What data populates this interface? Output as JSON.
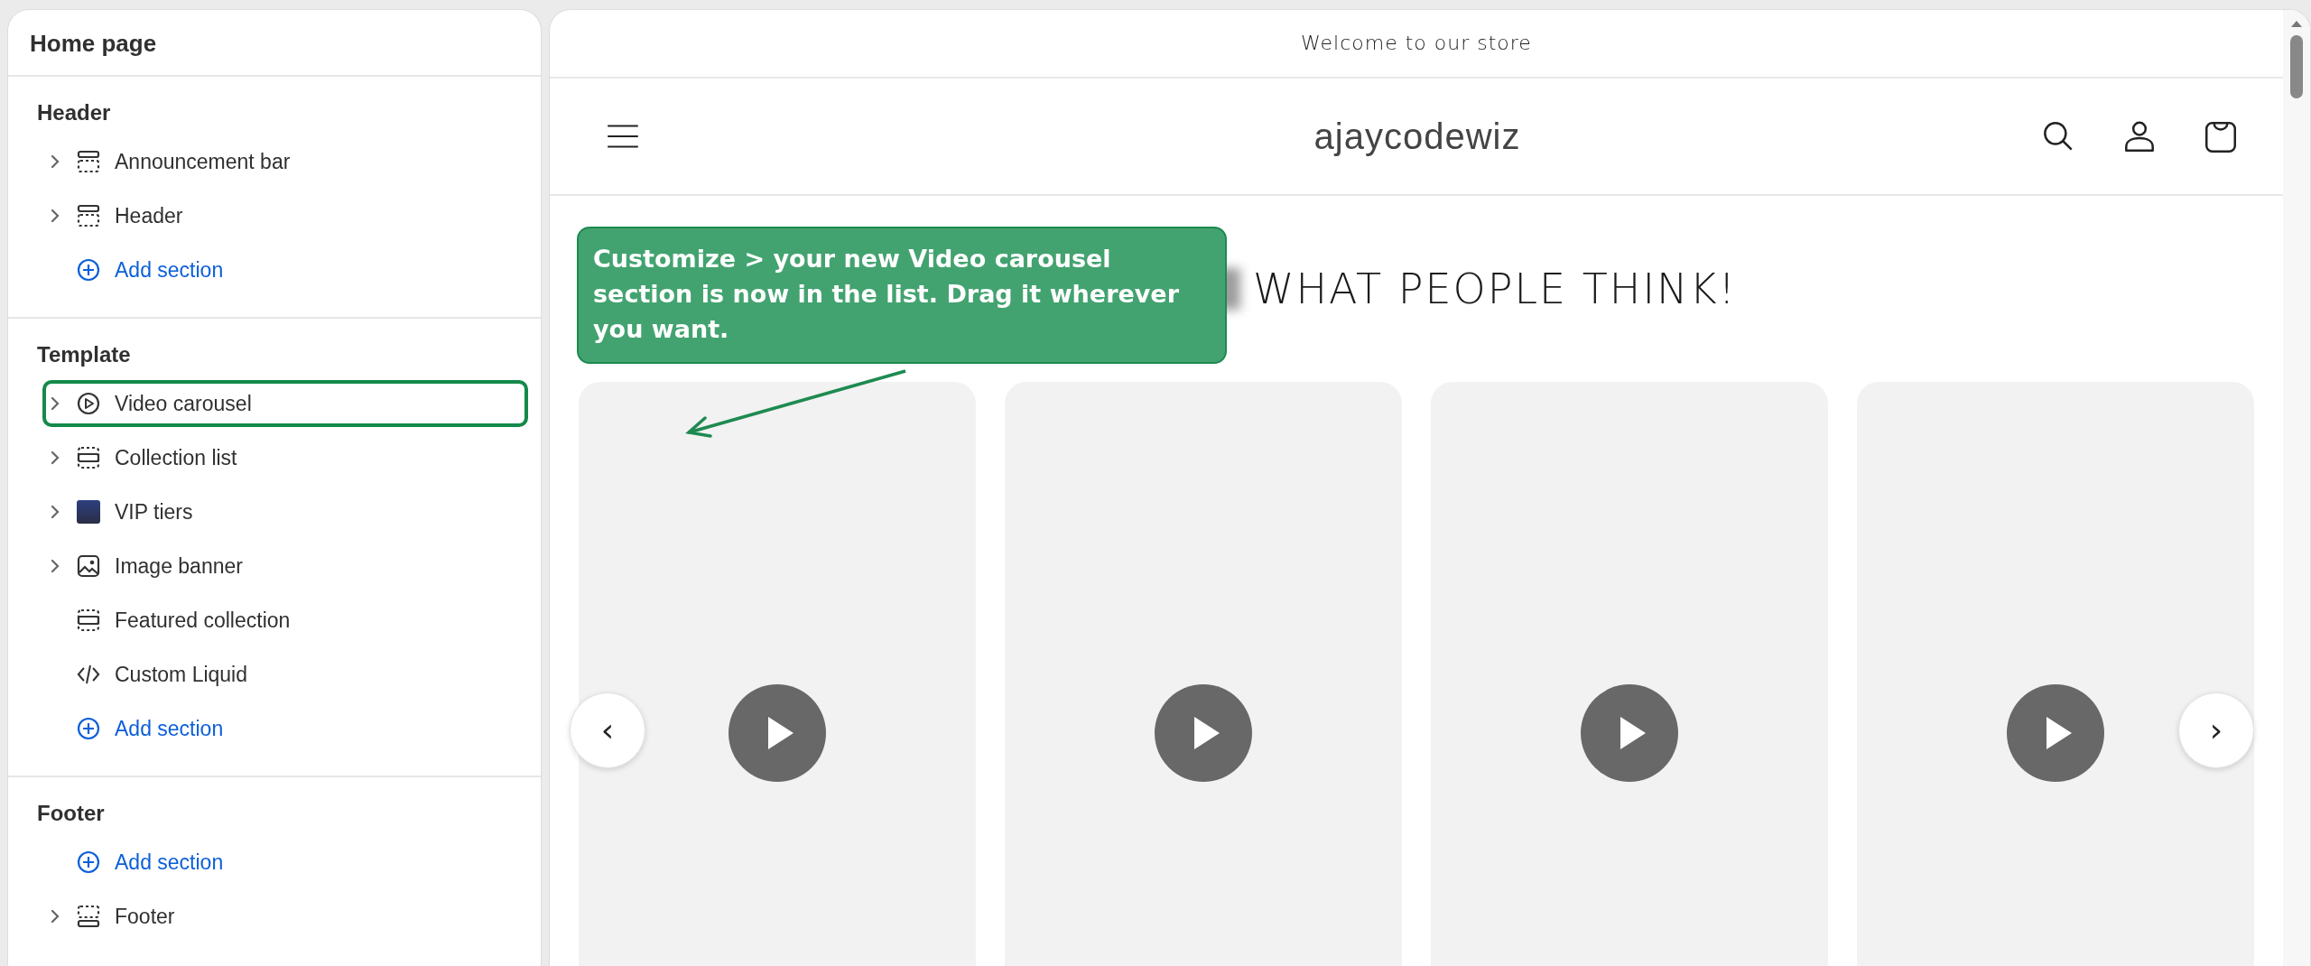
{
  "sidebar": {
    "title": "Home page",
    "groups": [
      {
        "heading": "Header",
        "items": [
          {
            "kind": "topbar",
            "label": "Announcement bar",
            "expandable": true,
            "highlighted": false
          },
          {
            "kind": "topbar",
            "label": "Header",
            "expandable": true,
            "highlighted": false
          },
          {
            "kind": "add",
            "label": "Add section"
          }
        ]
      },
      {
        "heading": "Template",
        "items": [
          {
            "kind": "video",
            "label": "Video carousel",
            "expandable": true,
            "highlighted": true
          },
          {
            "kind": "stack",
            "label": "Collection list",
            "expandable": true,
            "highlighted": false
          },
          {
            "kind": "thumbnail",
            "label": "VIP tiers",
            "expandable": true,
            "highlighted": false
          },
          {
            "kind": "image",
            "label": "Image banner",
            "expandable": true,
            "highlighted": false
          },
          {
            "kind": "stack",
            "label": "Featured collection",
            "expandable": false,
            "highlighted": false
          },
          {
            "kind": "code",
            "label": "Custom Liquid",
            "expandable": false,
            "highlighted": false
          },
          {
            "kind": "add",
            "label": "Add section"
          }
        ]
      },
      {
        "heading": "Footer",
        "items": [
          {
            "kind": "add",
            "label": "Add section"
          },
          {
            "kind": "bottombar",
            "label": "Footer",
            "expandable": true,
            "highlighted": false
          }
        ]
      }
    ]
  },
  "preview": {
    "announcement": "Welcome to our store",
    "store_name": "ajaycodewiz",
    "heading": "WHAT PEOPLE THINK!",
    "carousel": {
      "prev": "‹",
      "next": "›",
      "cards": [
        {
          "kind": "video"
        },
        {
          "kind": "video"
        },
        {
          "kind": "video"
        },
        {
          "kind": "video"
        }
      ]
    }
  },
  "callout": {
    "text": "Customize > your new Video carousel section is now in the list. Drag it wherever you want."
  }
}
